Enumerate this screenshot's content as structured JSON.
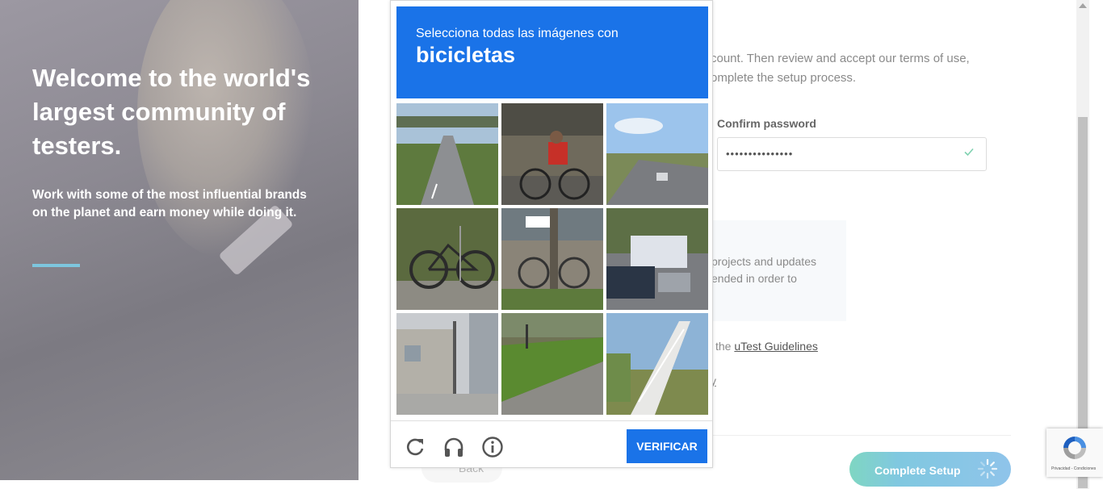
{
  "hero": {
    "title": "Welcome to the world's largest community of testers.",
    "subtitle": "Work with some of the most influential brands on the planet and earn money while doing it.",
    "accent_color": "#7dc6de"
  },
  "form": {
    "intro_line1": "count. Then review and accept our terms of use,",
    "intro_line2": "omplete the setup process.",
    "confirm_password_label": "Confirm password",
    "confirm_password_value": "•••••••••••••••",
    "info_line1": "projects and updates",
    "info_line2": "ended in order to",
    "guidelines_prefix": "the",
    "guidelines_link": "uTest Guidelines",
    "y_fragment": "y",
    "back_label": "Back",
    "complete_label": "Complete Setup"
  },
  "captcha": {
    "instruction": "Selecciona todas las imágenes con",
    "target": "bicicletas",
    "verify_label": "VERIFICAR",
    "header_color": "#1a73e8",
    "tiles": [
      {
        "id": "tile-1",
        "desc": "road-overpass"
      },
      {
        "id": "tile-2",
        "desc": "cyclist-red-shirt"
      },
      {
        "id": "tile-3",
        "desc": "highway-cars"
      },
      {
        "id": "tile-4",
        "desc": "parked-bicycle"
      },
      {
        "id": "tile-5",
        "desc": "bicycle-by-tree"
      },
      {
        "id": "tile-6",
        "desc": "street-traffic-bus"
      },
      {
        "id": "tile-7",
        "desc": "street-buildings"
      },
      {
        "id": "tile-8",
        "desc": "road-median"
      },
      {
        "id": "tile-9",
        "desc": "pedestrian-bridge-stairs"
      }
    ],
    "icons": [
      "reload-icon",
      "audio-icon",
      "info-icon"
    ]
  },
  "recaptcha_badge": {
    "footer": "Privacidad - Condiciones"
  }
}
